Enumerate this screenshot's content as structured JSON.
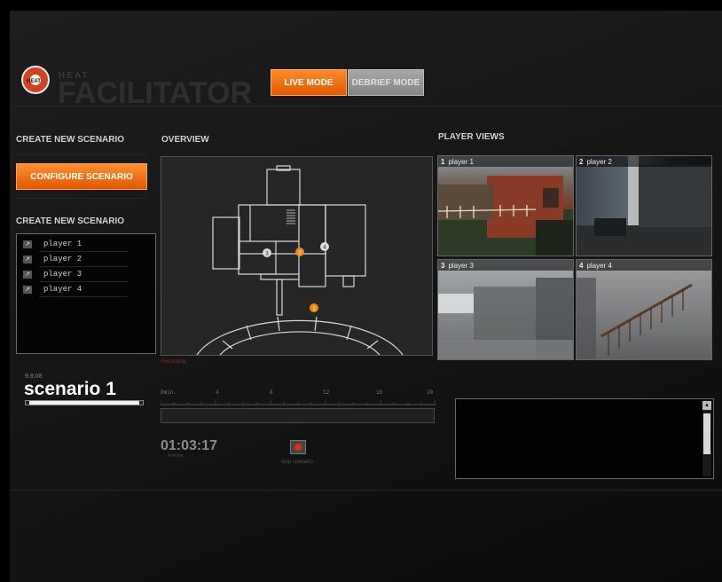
{
  "app": {
    "logo_text": "HEAT",
    "brand_small": "HEAT",
    "brand_large": "FACILITATOR"
  },
  "modes": {
    "live": "LIVE MODE",
    "debrief": "DEBRIEF MODE",
    "active": "live"
  },
  "left_panel": {
    "create_header_1": "CREATE NEW SCENARIO",
    "configure_button": "CONFIGURE SCENARIO",
    "create_header_2": "CREATE NEW SCENARIO",
    "players": [
      {
        "name": "player 1",
        "icon": "arrow-icon"
      },
      {
        "name": "player 2",
        "icon": "arrow-icon"
      },
      {
        "name": "player 3",
        "icon": "arrow-icon"
      },
      {
        "name": "player 4",
        "icon": "arrow-icon"
      }
    ]
  },
  "overview": {
    "header": "OVERVIEW",
    "recording_label": "Recording",
    "markers": [
      {
        "label": "1",
        "color": "#f08a10"
      },
      {
        "label": "2",
        "color": "#f08a10"
      },
      {
        "label": "3",
        "color": "#d8d8d8"
      },
      {
        "label": "4",
        "color": "#d8d8d8"
      }
    ]
  },
  "player_views": {
    "header": "PLAYER VIEWS",
    "cams": [
      {
        "num": "1",
        "label": "player 1"
      },
      {
        "num": "2",
        "label": "player 2"
      },
      {
        "num": "3",
        "label": "player 3"
      },
      {
        "num": "4",
        "label": "player 4"
      }
    ]
  },
  "scenario": {
    "date": "9.9.08",
    "name": "scenario 1"
  },
  "timeline": {
    "ticks": [
      "0min.",
      "4",
      "8",
      "12",
      "16",
      "20"
    ],
    "elapsed": "01:03:17",
    "hms_labels": "h    m    ms",
    "stop_label": "stop scenario"
  },
  "colors": {
    "accent": "#f07010",
    "record": "#e02a1a"
  }
}
